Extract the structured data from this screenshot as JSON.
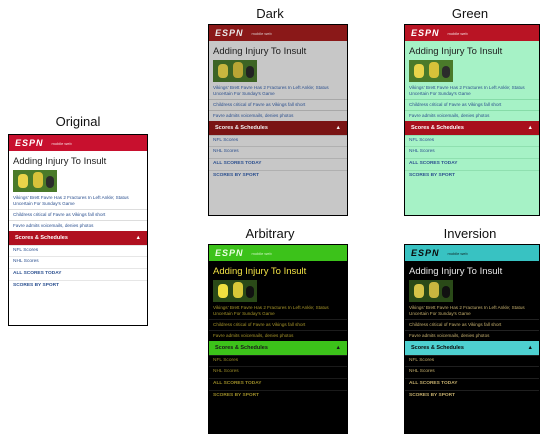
{
  "labels": {
    "original": "Original",
    "dark": "Dark",
    "green": "Green",
    "arbitrary": "Arbitrary",
    "inversion": "Inversion"
  },
  "page": {
    "logo": "ESPN",
    "header_sub": "mobile web",
    "title": "Adding Injury To Insult",
    "links": [
      "Vikings' Brett Favre Has 2 Fractures In Left Ankle; Status Uncertain For Sunday's Game",
      "Childress critical of Favre as Vikings fall short",
      "Favre admits voicemails, denies photos"
    ],
    "section_title": "Scores & Schedules",
    "section_arrow": "▲",
    "rows": [
      "NFL Scores",
      "NHL Scores",
      "ALL SCORES TODAY",
      "SCORES BY SPORT"
    ]
  },
  "colors": {
    "original_header": "#c8102e",
    "dark_background": "#c7c7c7",
    "green_background": "#a6f2c6",
    "arbitrary_accent": "#3cc21a",
    "inversion_accent": "#38c2c2"
  }
}
